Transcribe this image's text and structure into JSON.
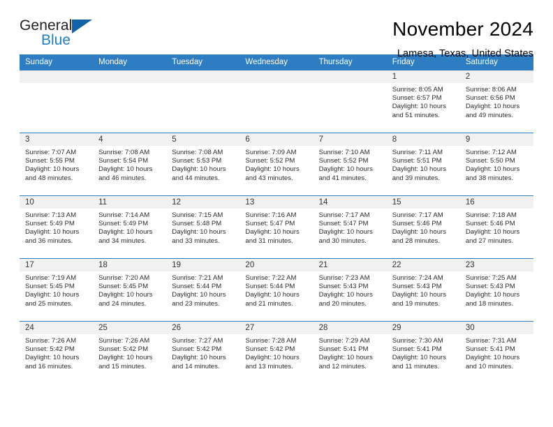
{
  "brand": {
    "word_one": "General",
    "word_two": "Blue",
    "triangle_color": "#1162a6",
    "blue_text_color": "#1d80c4"
  },
  "header": {
    "title": "November 2024",
    "subtitle": "Lamesa, Texas, United States"
  },
  "theme": {
    "header_row_bg": "#2e7cc1",
    "day_number_bg": "#f1f1f1",
    "cell_border": "#2e7cc1"
  },
  "weekdays": [
    "Sunday",
    "Monday",
    "Tuesday",
    "Wednesday",
    "Thursday",
    "Friday",
    "Saturday"
  ],
  "labels": {
    "sunrise_prefix": "Sunrise:",
    "sunset_prefix": "Sunset:",
    "daylight_prefix": "Daylight:"
  },
  "weeks": [
    [
      {
        "empty": true
      },
      {
        "empty": true
      },
      {
        "empty": true
      },
      {
        "empty": true
      },
      {
        "empty": true
      },
      {
        "empty": false,
        "day": "1",
        "sunrise": "Sunrise: 8:05 AM",
        "sunset": "Sunset: 6:57 PM",
        "daylight": "Daylight: 10 hours and 51 minutes."
      },
      {
        "empty": false,
        "day": "2",
        "sunrise": "Sunrise: 8:06 AM",
        "sunset": "Sunset: 6:56 PM",
        "daylight": "Daylight: 10 hours and 49 minutes."
      }
    ],
    [
      {
        "empty": false,
        "day": "3",
        "sunrise": "Sunrise: 7:07 AM",
        "sunset": "Sunset: 5:55 PM",
        "daylight": "Daylight: 10 hours and 48 minutes."
      },
      {
        "empty": false,
        "day": "4",
        "sunrise": "Sunrise: 7:08 AM",
        "sunset": "Sunset: 5:54 PM",
        "daylight": "Daylight: 10 hours and 46 minutes."
      },
      {
        "empty": false,
        "day": "5",
        "sunrise": "Sunrise: 7:08 AM",
        "sunset": "Sunset: 5:53 PM",
        "daylight": "Daylight: 10 hours and 44 minutes."
      },
      {
        "empty": false,
        "day": "6",
        "sunrise": "Sunrise: 7:09 AM",
        "sunset": "Sunset: 5:52 PM",
        "daylight": "Daylight: 10 hours and 43 minutes."
      },
      {
        "empty": false,
        "day": "7",
        "sunrise": "Sunrise: 7:10 AM",
        "sunset": "Sunset: 5:52 PM",
        "daylight": "Daylight: 10 hours and 41 minutes."
      },
      {
        "empty": false,
        "day": "8",
        "sunrise": "Sunrise: 7:11 AM",
        "sunset": "Sunset: 5:51 PM",
        "daylight": "Daylight: 10 hours and 39 minutes."
      },
      {
        "empty": false,
        "day": "9",
        "sunrise": "Sunrise: 7:12 AM",
        "sunset": "Sunset: 5:50 PM",
        "daylight": "Daylight: 10 hours and 38 minutes."
      }
    ],
    [
      {
        "empty": false,
        "day": "10",
        "sunrise": "Sunrise: 7:13 AM",
        "sunset": "Sunset: 5:49 PM",
        "daylight": "Daylight: 10 hours and 36 minutes."
      },
      {
        "empty": false,
        "day": "11",
        "sunrise": "Sunrise: 7:14 AM",
        "sunset": "Sunset: 5:49 PM",
        "daylight": "Daylight: 10 hours and 34 minutes."
      },
      {
        "empty": false,
        "day": "12",
        "sunrise": "Sunrise: 7:15 AM",
        "sunset": "Sunset: 5:48 PM",
        "daylight": "Daylight: 10 hours and 33 minutes."
      },
      {
        "empty": false,
        "day": "13",
        "sunrise": "Sunrise: 7:16 AM",
        "sunset": "Sunset: 5:47 PM",
        "daylight": "Daylight: 10 hours and 31 minutes."
      },
      {
        "empty": false,
        "day": "14",
        "sunrise": "Sunrise: 7:17 AM",
        "sunset": "Sunset: 5:47 PM",
        "daylight": "Daylight: 10 hours and 30 minutes."
      },
      {
        "empty": false,
        "day": "15",
        "sunrise": "Sunrise: 7:17 AM",
        "sunset": "Sunset: 5:46 PM",
        "daylight": "Daylight: 10 hours and 28 minutes."
      },
      {
        "empty": false,
        "day": "16",
        "sunrise": "Sunrise: 7:18 AM",
        "sunset": "Sunset: 5:46 PM",
        "daylight": "Daylight: 10 hours and 27 minutes."
      }
    ],
    [
      {
        "empty": false,
        "day": "17",
        "sunrise": "Sunrise: 7:19 AM",
        "sunset": "Sunset: 5:45 PM",
        "daylight": "Daylight: 10 hours and 25 minutes."
      },
      {
        "empty": false,
        "day": "18",
        "sunrise": "Sunrise: 7:20 AM",
        "sunset": "Sunset: 5:45 PM",
        "daylight": "Daylight: 10 hours and 24 minutes."
      },
      {
        "empty": false,
        "day": "19",
        "sunrise": "Sunrise: 7:21 AM",
        "sunset": "Sunset: 5:44 PM",
        "daylight": "Daylight: 10 hours and 23 minutes."
      },
      {
        "empty": false,
        "day": "20",
        "sunrise": "Sunrise: 7:22 AM",
        "sunset": "Sunset: 5:44 PM",
        "daylight": "Daylight: 10 hours and 21 minutes."
      },
      {
        "empty": false,
        "day": "21",
        "sunrise": "Sunrise: 7:23 AM",
        "sunset": "Sunset: 5:43 PM",
        "daylight": "Daylight: 10 hours and 20 minutes."
      },
      {
        "empty": false,
        "day": "22",
        "sunrise": "Sunrise: 7:24 AM",
        "sunset": "Sunset: 5:43 PM",
        "daylight": "Daylight: 10 hours and 19 minutes."
      },
      {
        "empty": false,
        "day": "23",
        "sunrise": "Sunrise: 7:25 AM",
        "sunset": "Sunset: 5:43 PM",
        "daylight": "Daylight: 10 hours and 18 minutes."
      }
    ],
    [
      {
        "empty": false,
        "day": "24",
        "sunrise": "Sunrise: 7:26 AM",
        "sunset": "Sunset: 5:42 PM",
        "daylight": "Daylight: 10 hours and 16 minutes."
      },
      {
        "empty": false,
        "day": "25",
        "sunrise": "Sunrise: 7:26 AM",
        "sunset": "Sunset: 5:42 PM",
        "daylight": "Daylight: 10 hours and 15 minutes."
      },
      {
        "empty": false,
        "day": "26",
        "sunrise": "Sunrise: 7:27 AM",
        "sunset": "Sunset: 5:42 PM",
        "daylight": "Daylight: 10 hours and 14 minutes."
      },
      {
        "empty": false,
        "day": "27",
        "sunrise": "Sunrise: 7:28 AM",
        "sunset": "Sunset: 5:42 PM",
        "daylight": "Daylight: 10 hours and 13 minutes."
      },
      {
        "empty": false,
        "day": "28",
        "sunrise": "Sunrise: 7:29 AM",
        "sunset": "Sunset: 5:41 PM",
        "daylight": "Daylight: 10 hours and 12 minutes."
      },
      {
        "empty": false,
        "day": "29",
        "sunrise": "Sunrise: 7:30 AM",
        "sunset": "Sunset: 5:41 PM",
        "daylight": "Daylight: 10 hours and 11 minutes."
      },
      {
        "empty": false,
        "day": "30",
        "sunrise": "Sunrise: 7:31 AM",
        "sunset": "Sunset: 5:41 PM",
        "daylight": "Daylight: 10 hours and 10 minutes."
      }
    ]
  ]
}
